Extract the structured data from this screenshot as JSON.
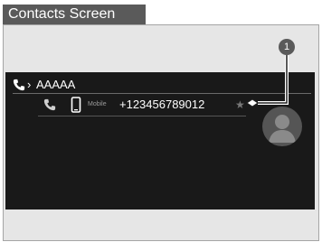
{
  "header": {
    "title": "Contacts Screen"
  },
  "contact": {
    "chevron": "›",
    "name": "AAAAA"
  },
  "number_entry": {
    "type_label": "Mobile",
    "number": "+123456789012",
    "favorite": "★"
  },
  "callout": {
    "label": "1"
  },
  "colors": {
    "screen_bg": "#191919",
    "title_bg": "#5a5a5a",
    "frame_bg": "#e6e6e6"
  }
}
